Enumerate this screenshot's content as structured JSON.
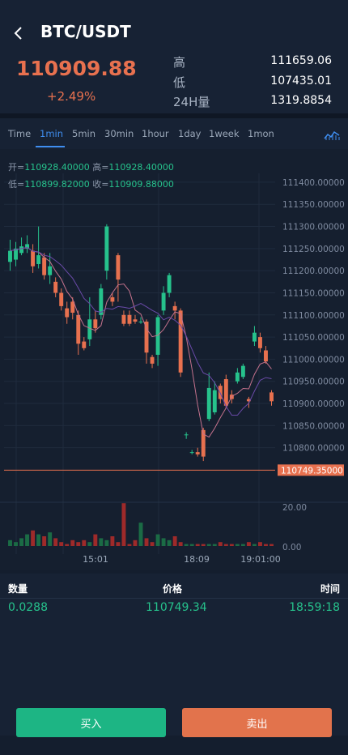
{
  "header": {
    "title": "BTC/USDT",
    "price": "110909.88",
    "change": "+2.49%",
    "stats": [
      {
        "label": "高",
        "value": "111659.06"
      },
      {
        "label": "低",
        "value": "107435.01"
      },
      {
        "label": "24H量",
        "value": "1319.8854"
      }
    ]
  },
  "tabs": [
    {
      "label": "Time",
      "active": false
    },
    {
      "label": "1min",
      "active": true
    },
    {
      "label": "5min",
      "active": false
    },
    {
      "label": "30min",
      "active": false
    },
    {
      "label": "1hour",
      "active": false
    },
    {
      "label": "1day",
      "active": false
    },
    {
      "label": "1week",
      "active": false
    },
    {
      "label": "1mon",
      "active": false
    }
  ],
  "ohlc": {
    "open_label": "开=",
    "open": "110928.40000",
    "high_label": "高=",
    "high": "110928.40000",
    "low_label": "低=",
    "low": "110899.82000",
    "close_label": "收=",
    "close": "110909.88000"
  },
  "chart_data": {
    "type": "candlestick",
    "y_ticks": [
      "111400.00000",
      "111350.00000",
      "111300.00000",
      "111250.00000",
      "111200.00000",
      "111150.00000",
      "111100.00000",
      "111050.00000",
      "111000.00000",
      "110950.00000",
      "110900.00000",
      "110850.00000",
      "110800.00000"
    ],
    "ylim": [
      110750,
      111420
    ],
    "current_price_label": "110749.35000",
    "current_price": 110749.35,
    "volume_ticks": [
      "20.00",
      "0.00"
    ],
    "x_ticks": [
      "15:01",
      "18:09",
      "19:01:00"
    ],
    "candles": [
      {
        "o": 111220,
        "c": 111245,
        "h": 111270,
        "l": 111200
      },
      {
        "o": 111225,
        "c": 111250,
        "h": 111265,
        "l": 111210
      },
      {
        "o": 111240,
        "c": 111255,
        "h": 111275,
        "l": 111235
      },
      {
        "o": 111250,
        "c": 111260,
        "h": 111280,
        "l": 111240
      },
      {
        "o": 111245,
        "c": 111210,
        "h": 111260,
        "l": 111195
      },
      {
        "o": 111215,
        "c": 111235,
        "h": 111300,
        "l": 111205
      },
      {
        "o": 111230,
        "c": 111190,
        "h": 111240,
        "l": 111180
      },
      {
        "o": 111190,
        "c": 111210,
        "h": 111240,
        "l": 111170
      },
      {
        "o": 111175,
        "c": 111150,
        "h": 111185,
        "l": 111140
      },
      {
        "o": 111150,
        "c": 111120,
        "h": 111160,
        "l": 111110
      },
      {
        "o": 111115,
        "c": 111095,
        "h": 111130,
        "l": 111080
      },
      {
        "o": 111130,
        "c": 111105,
        "h": 111140,
        "l": 111090
      },
      {
        "o": 111100,
        "c": 111035,
        "h": 111110,
        "l": 111010
      },
      {
        "o": 111040,
        "c": 111025,
        "h": 111050,
        "l": 111020
      },
      {
        "o": 111045,
        "c": 111090,
        "h": 111140,
        "l": 111030
      },
      {
        "o": 111090,
        "c": 111070,
        "h": 111110,
        "l": 111060
      },
      {
        "o": 111100,
        "c": 111160,
        "h": 111170,
        "l": 111090
      },
      {
        "o": 111200,
        "c": 111300,
        "h": 111305,
        "l": 111180
      },
      {
        "o": 111140,
        "c": 111130,
        "h": 111150,
        "l": 111120
      },
      {
        "o": 111235,
        "c": 111180,
        "h": 111240,
        "l": 111130
      },
      {
        "o": 111100,
        "c": 111080,
        "h": 111110,
        "l": 111075
      },
      {
        "o": 111100,
        "c": 111080,
        "h": 111110,
        "l": 111075
      },
      {
        "o": 111090,
        "c": 111085,
        "h": 111100,
        "l": 111080
      },
      {
        "o": 111085,
        "c": 111085,
        "h": 111095,
        "l": 111080
      },
      {
        "o": 111085,
        "c": 111015,
        "h": 111090,
        "l": 110990
      },
      {
        "o": 111005,
        "c": 110990,
        "h": 111010,
        "l": 110980
      },
      {
        "o": 111010,
        "c": 111095,
        "h": 111100,
        "l": 110985
      },
      {
        "o": 111110,
        "c": 111150,
        "h": 111165,
        "l": 111100
      },
      {
        "o": 111150,
        "c": 111190,
        "h": 111195,
        "l": 111140
      },
      {
        "o": 111120,
        "c": 111110,
        "h": 111130,
        "l": 111090
      },
      {
        "o": 111110,
        "c": 110970,
        "h": 111115,
        "l": 110960
      },
      {
        "o": 110830,
        "c": 110830,
        "h": 110835,
        "l": 110820
      },
      {
        "o": 110790,
        "c": 110790,
        "h": 110795,
        "l": 110785
      },
      {
        "o": 110790,
        "c": 110785,
        "h": 110800,
        "l": 110780
      },
      {
        "o": 110840,
        "c": 110780,
        "h": 110845,
        "l": 110770
      },
      {
        "o": 110865,
        "c": 110935,
        "h": 110970,
        "l": 110860
      },
      {
        "o": 110880,
        "c": 110930,
        "h": 110950,
        "l": 110875
      },
      {
        "o": 110940,
        "c": 110910,
        "h": 110945,
        "l": 110900
      },
      {
        "o": 110955,
        "c": 110895,
        "h": 110965,
        "l": 110890
      },
      {
        "o": 110920,
        "c": 110910,
        "h": 110930,
        "l": 110900
      },
      {
        "o": 110950,
        "c": 110970,
        "h": 110980,
        "l": 110945
      },
      {
        "o": 110960,
        "c": 110985,
        "h": 110990,
        "l": 110955
      },
      {
        "o": 110910,
        "c": 110905,
        "h": 110915,
        "l": 110890
      },
      {
        "o": 111040,
        "c": 111060,
        "h": 111075,
        "l": 111030
      },
      {
        "o": 111050,
        "c": 111025,
        "h": 111060,
        "l": 111015
      },
      {
        "o": 111020,
        "c": 110995,
        "h": 111030,
        "l": 110990
      },
      {
        "o": 110925,
        "c": 110905,
        "h": 110930,
        "l": 110895
      }
    ],
    "volume": [
      3,
      2,
      4,
      6,
      8,
      6,
      5,
      7,
      4,
      2,
      1,
      3,
      2,
      3,
      2,
      6,
      4,
      3,
      5,
      2,
      22,
      1,
      3,
      12,
      4,
      2,
      6,
      4,
      3,
      5,
      2,
      1,
      1,
      1,
      1,
      1,
      1,
      2,
      1,
      1,
      1,
      1,
      2,
      1,
      2,
      1,
      1
    ]
  },
  "trades": {
    "headers": [
      "数量",
      "价格",
      "时间"
    ],
    "rows": [
      {
        "qty": "0.0288",
        "price": "110749.34",
        "time": "18:59:18"
      }
    ]
  },
  "actions": {
    "buy": "买入",
    "sell": "卖出"
  },
  "colors": {
    "up": "#26c28c",
    "down": "#e8714f",
    "accent": "#3f8ef0"
  }
}
